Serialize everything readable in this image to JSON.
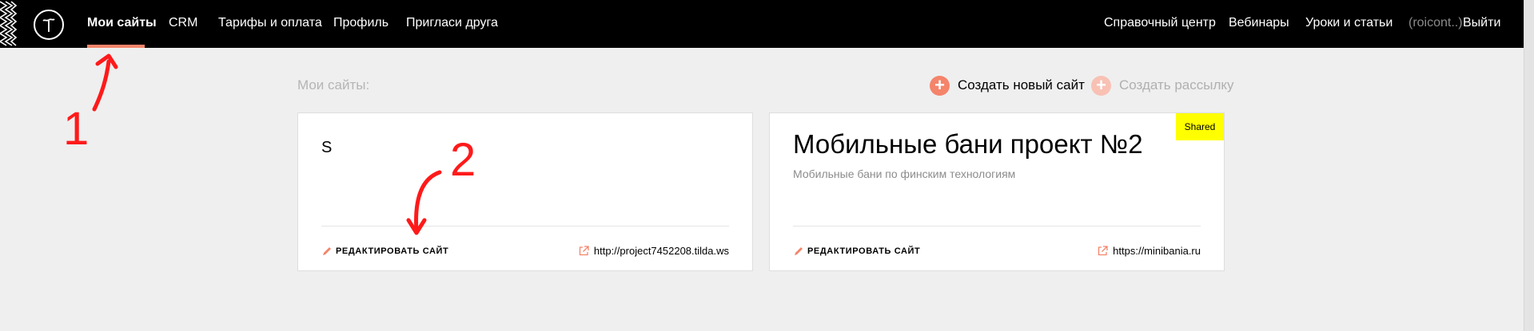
{
  "nav": {
    "left": [
      {
        "label": "Мои сайты",
        "active": true
      },
      {
        "label": "CRM"
      },
      {
        "label": "Тарифы и оплата"
      },
      {
        "label": "Профиль"
      },
      {
        "label": "Пригласи друга"
      }
    ],
    "right": [
      {
        "label": "Справочный центр"
      },
      {
        "label": "Вебинары"
      },
      {
        "label": "Уроки и статьи"
      },
      {
        "label": "(roicont..)"
      },
      {
        "label": "Выйти"
      }
    ]
  },
  "main": {
    "heading": "Мои сайты:",
    "create_site": "Создать новый сайт",
    "create_newsletter": "Создать рассылку"
  },
  "cards": [
    {
      "title": "S",
      "description": "",
      "edit_label": "РЕДАКТИРОВАТЬ САЙТ",
      "url": "http://project7452208.tilda.ws",
      "badge": ""
    },
    {
      "title": "Мобильные бани проект №2",
      "description": "Мобильные бани по финским технологиям",
      "edit_label": "РЕДАКТИРОВАТЬ САЙТ",
      "url": "https://minibania.ru",
      "badge": "Shared"
    }
  ],
  "annotations": {
    "one": "1",
    "two": "2"
  },
  "colors": {
    "accent": "#f4846a",
    "annotation": "#ff1a1a",
    "badge": "#ffff00",
    "topbar": "#000000"
  }
}
